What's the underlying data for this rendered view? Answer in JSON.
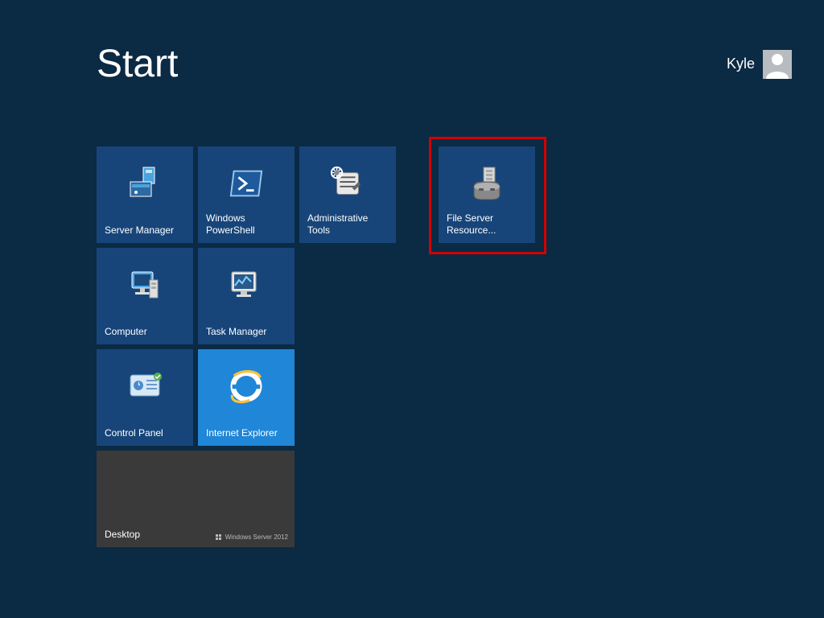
{
  "header": {
    "title": "Start",
    "user_name": "Kyle"
  },
  "tiles": {
    "server_manager": "Server Manager",
    "windows_powershell": "Windows PowerShell",
    "administrative_tools": "Administrative Tools",
    "computer": "Computer",
    "task_manager": "Task Manager",
    "control_panel": "Control Panel",
    "internet_explorer": "Internet Explorer",
    "desktop": "Desktop",
    "desktop_sub": "Windows Server 2012",
    "file_server_resource": "File Server Resource..."
  },
  "colors": {
    "background": "#0b2a44",
    "tile": "#17457a",
    "tile_bright": "#2086d7",
    "tile_dark": "#3a3a3a",
    "highlight": "#d40000"
  }
}
